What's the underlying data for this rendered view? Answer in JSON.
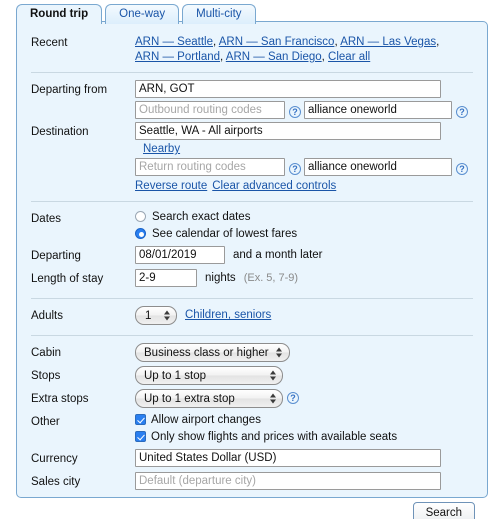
{
  "tabs": [
    {
      "label": "Round trip",
      "active": true
    },
    {
      "label": "One-way",
      "active": false
    },
    {
      "label": "Multi-city",
      "active": false
    }
  ],
  "recent": {
    "label": "Recent",
    "items": [
      "ARN — Seattle",
      "ARN — San Francisco",
      "ARN — Las Vegas",
      "ARN — Portland",
      "ARN — San Diego"
    ],
    "clear_all": "Clear all"
  },
  "route": {
    "departing_label": "Departing from",
    "departing_value": "ARN, GOT",
    "outbound_routing_placeholder": "Outbound routing codes",
    "outbound_alliance_value": "alliance oneworld",
    "destination_label": "Destination",
    "destination_value": "Seattle, WA - All airports",
    "nearby_link": "Nearby",
    "return_routing_placeholder": "Return routing codes",
    "return_alliance_value": "alliance oneworld",
    "reverse_route_link": "Reverse route",
    "clear_advanced_link": "Clear advanced controls",
    "help_icon": "help-icon"
  },
  "dates": {
    "label": "Dates",
    "option_exact": "Search exact dates",
    "option_calendar": "See calendar of lowest fares",
    "selected_option": "calendar",
    "departing_label": "Departing",
    "departing_value": "08/01/2019",
    "departing_suffix": "and a month later",
    "stay_label": "Length of stay",
    "stay_value": "2-9",
    "stay_unit": "nights",
    "stay_hint": "(Ex. 5, 7-9)"
  },
  "passengers": {
    "label": "Adults",
    "adults_value": "1",
    "children_link": "Children, seniors"
  },
  "options": {
    "cabin_label": "Cabin",
    "cabin_value": "Business class or higher",
    "stops_label": "Stops",
    "stops_value": "Up to 1 stop",
    "extra_stops_label": "Extra stops",
    "extra_stops_value": "Up to 1 extra stop",
    "other_label": "Other",
    "allow_airport_changes": "Allow airport changes",
    "allow_airport_changes_checked": true,
    "only_available_seats": "Only show flights and prices with available seats",
    "only_available_seats_checked": true,
    "currency_label": "Currency",
    "currency_value": "United States Dollar (USD)",
    "sales_city_label": "Sales city",
    "sales_city_placeholder": "Default (departure city)"
  },
  "actions": {
    "search_label": "Search"
  },
  "colors": {
    "panel_bg": "#eaf5fd",
    "panel_border": "#7aa8d0",
    "link": "#1a55a8",
    "accent": "#2a7ff0",
    "divider": "#c9d8e2"
  }
}
